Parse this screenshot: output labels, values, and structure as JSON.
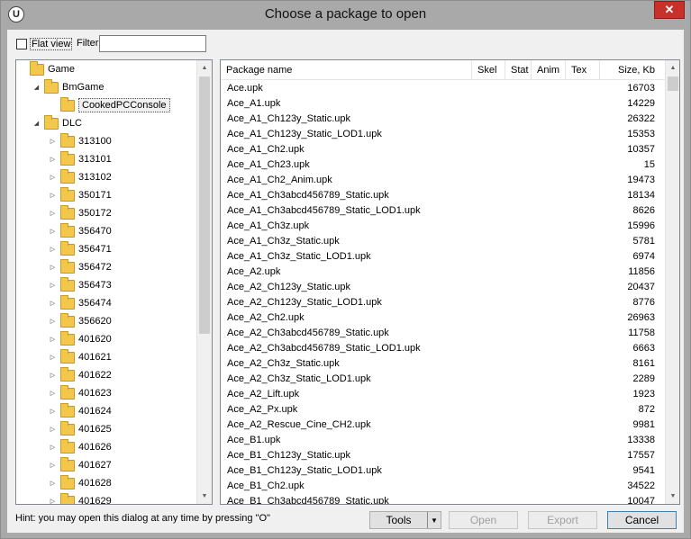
{
  "window": {
    "title": "Choose a package to open",
    "app_icon": "U",
    "close_glyph": "✕"
  },
  "toolbar": {
    "flat_view_label": "Flat view",
    "filter_label": "Filter:",
    "filter_value": ""
  },
  "tree": {
    "items": [
      {
        "label": "Game",
        "level": 0,
        "expander": "",
        "selected": false
      },
      {
        "label": "BmGame",
        "level": 1,
        "expander": "◢",
        "selected": false
      },
      {
        "label": "CookedPCConsole",
        "level": 2,
        "expander": "",
        "selected": true
      },
      {
        "label": "DLC",
        "level": 1,
        "expander": "◢",
        "selected": false
      },
      {
        "label": "313100",
        "level": 2,
        "expander": "▷",
        "selected": false
      },
      {
        "label": "313101",
        "level": 2,
        "expander": "▷",
        "selected": false
      },
      {
        "label": "313102",
        "level": 2,
        "expander": "▷",
        "selected": false
      },
      {
        "label": "350171",
        "level": 2,
        "expander": "▷",
        "selected": false
      },
      {
        "label": "350172",
        "level": 2,
        "expander": "▷",
        "selected": false
      },
      {
        "label": "356470",
        "level": 2,
        "expander": "▷",
        "selected": false
      },
      {
        "label": "356471",
        "level": 2,
        "expander": "▷",
        "selected": false
      },
      {
        "label": "356472",
        "level": 2,
        "expander": "▷",
        "selected": false
      },
      {
        "label": "356473",
        "level": 2,
        "expander": "▷",
        "selected": false
      },
      {
        "label": "356474",
        "level": 2,
        "expander": "▷",
        "selected": false
      },
      {
        "label": "356620",
        "level": 2,
        "expander": "▷",
        "selected": false
      },
      {
        "label": "401620",
        "level": 2,
        "expander": "▷",
        "selected": false
      },
      {
        "label": "401621",
        "level": 2,
        "expander": "▷",
        "selected": false
      },
      {
        "label": "401622",
        "level": 2,
        "expander": "▷",
        "selected": false
      },
      {
        "label": "401623",
        "level": 2,
        "expander": "▷",
        "selected": false
      },
      {
        "label": "401624",
        "level": 2,
        "expander": "▷",
        "selected": false
      },
      {
        "label": "401625",
        "level": 2,
        "expander": "▷",
        "selected": false
      },
      {
        "label": "401626",
        "level": 2,
        "expander": "▷",
        "selected": false
      },
      {
        "label": "401627",
        "level": 2,
        "expander": "▷",
        "selected": false
      },
      {
        "label": "401628",
        "level": 2,
        "expander": "▷",
        "selected": false
      },
      {
        "label": "401629",
        "level": 2,
        "expander": "▷",
        "selected": false
      }
    ]
  },
  "list": {
    "columns": [
      "Package name",
      "Skel",
      "Stat",
      "Anim",
      "Tex",
      "Size, Kb"
    ],
    "rows": [
      {
        "name": "Ace.upk",
        "size": "16703"
      },
      {
        "name": "Ace_A1.upk",
        "size": "14229"
      },
      {
        "name": "Ace_A1_Ch123y_Static.upk",
        "size": "26322"
      },
      {
        "name": "Ace_A1_Ch123y_Static_LOD1.upk",
        "size": "15353"
      },
      {
        "name": "Ace_A1_Ch2.upk",
        "size": "10357"
      },
      {
        "name": "Ace_A1_Ch23.upk",
        "size": "15"
      },
      {
        "name": "Ace_A1_Ch2_Anim.upk",
        "size": "19473"
      },
      {
        "name": "Ace_A1_Ch3abcd456789_Static.upk",
        "size": "18134"
      },
      {
        "name": "Ace_A1_Ch3abcd456789_Static_LOD1.upk",
        "size": "8626"
      },
      {
        "name": "Ace_A1_Ch3z.upk",
        "size": "15996"
      },
      {
        "name": "Ace_A1_Ch3z_Static.upk",
        "size": "5781"
      },
      {
        "name": "Ace_A1_Ch3z_Static_LOD1.upk",
        "size": "6974"
      },
      {
        "name": "Ace_A2.upk",
        "size": "11856"
      },
      {
        "name": "Ace_A2_Ch123y_Static.upk",
        "size": "20437"
      },
      {
        "name": "Ace_A2_Ch123y_Static_LOD1.upk",
        "size": "8776"
      },
      {
        "name": "Ace_A2_Ch2.upk",
        "size": "26963"
      },
      {
        "name": "Ace_A2_Ch3abcd456789_Static.upk",
        "size": "11758"
      },
      {
        "name": "Ace_A2_Ch3abcd456789_Static_LOD1.upk",
        "size": "6663"
      },
      {
        "name": "Ace_A2_Ch3z_Static.upk",
        "size": "8161"
      },
      {
        "name": "Ace_A2_Ch3z_Static_LOD1.upk",
        "size": "2289"
      },
      {
        "name": "Ace_A2_Lift.upk",
        "size": "1923"
      },
      {
        "name": "Ace_A2_Px.upk",
        "size": "872"
      },
      {
        "name": "Ace_A2_Rescue_Cine_CH2.upk",
        "size": "9981"
      },
      {
        "name": "Ace_B1.upk",
        "size": "13338"
      },
      {
        "name": "Ace_B1_Ch123y_Static.upk",
        "size": "17557"
      },
      {
        "name": "Ace_B1_Ch123y_Static_LOD1.upk",
        "size": "9541"
      },
      {
        "name": "Ace_B1_Ch2.upk",
        "size": "34522"
      },
      {
        "name": "Ace_B1_Ch3abcd456789_Static.upk",
        "size": "10047"
      }
    ]
  },
  "footer": {
    "hint": "Hint: you may open this dialog at any time by pressing \"O\"",
    "tools_label": "Tools",
    "open_label": "Open",
    "export_label": "Export",
    "cancel_label": "Cancel"
  },
  "icons": {
    "scroll_up": "▲",
    "scroll_down": "▼",
    "dropdown": "▼"
  }
}
